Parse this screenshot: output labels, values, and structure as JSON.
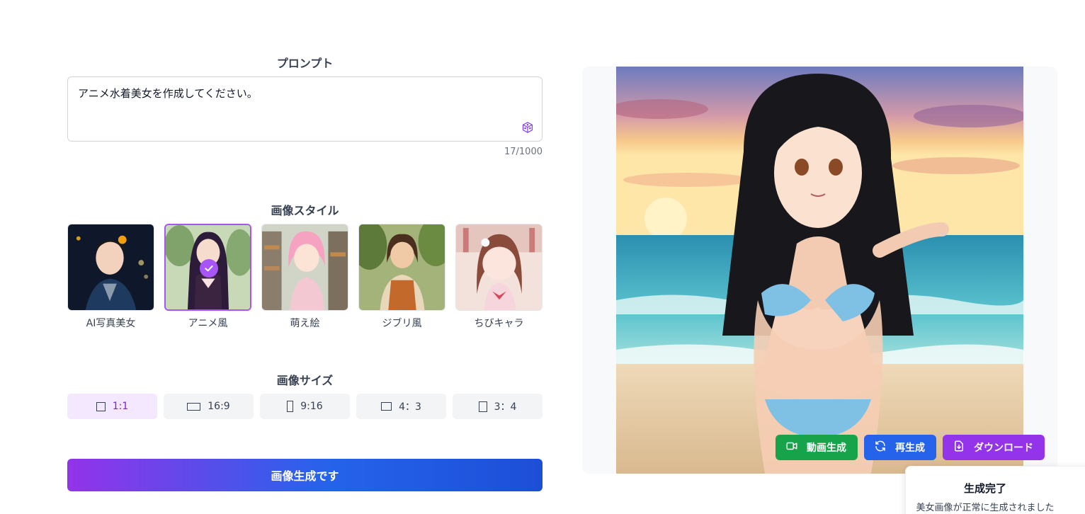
{
  "prompt": {
    "title": "プロンプト",
    "value": "アニメ水着美女を作成してください。",
    "counter": "17/1000"
  },
  "style_section": {
    "title": "画像スタイル",
    "items": [
      {
        "label": "AI写真美女",
        "selected": false
      },
      {
        "label": "アニメ風",
        "selected": true
      },
      {
        "label": "萌え絵",
        "selected": false
      },
      {
        "label": "ジブリ風",
        "selected": false
      },
      {
        "label": "ちびキャラ",
        "selected": false
      }
    ]
  },
  "size_section": {
    "title": "画像サイズ",
    "options": [
      {
        "label": "1:1",
        "active": true
      },
      {
        "label": "16:9",
        "active": false
      },
      {
        "label": "9:16",
        "active": false
      },
      {
        "label": "4：3",
        "active": false
      },
      {
        "label": "3：4",
        "active": false
      }
    ]
  },
  "generate_button": "画像生成です",
  "actions": {
    "video": "動画生成",
    "regenerate": "再生成",
    "download": "ダウンロード"
  },
  "toast": {
    "title": "生成完了",
    "message": "美女画像が正常に生成されました"
  },
  "colors": {
    "accent_purple": "#a855f7",
    "selected_bg": "#f3e8ff",
    "video_green": "#16a34a",
    "regen_blue": "#2563eb",
    "download_purple": "#9333ea"
  }
}
